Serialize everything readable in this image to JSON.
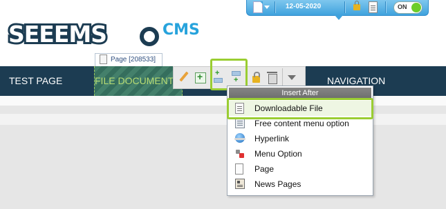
{
  "topbar": {
    "date": "12-05-2020",
    "toggle_label": "ON"
  },
  "logo": {
    "word": "SEEEMS",
    "suffix": "CMS"
  },
  "page_tag": {
    "label": "Page [208533]"
  },
  "navbar": {
    "items": [
      {
        "label": "TEST PAGE"
      },
      {
        "label": "FILE DOCUMENTS"
      },
      {
        "label": "NAVIGATION"
      }
    ]
  },
  "menu": {
    "header": "Insert After",
    "items": [
      {
        "label": "Downloadable File",
        "icon": "document-icon",
        "active": true
      },
      {
        "label": "Free content menu option",
        "icon": "content-icon"
      },
      {
        "label": "Hyperlink",
        "icon": "globe-icon"
      },
      {
        "label": "Menu Option",
        "icon": "menu-option-icon"
      },
      {
        "label": "Page",
        "icon": "page-icon"
      },
      {
        "label": "News Pages",
        "icon": "news-icon"
      }
    ]
  },
  "colors": {
    "nav_background": "#1c3c52",
    "highlight": "#9acd32",
    "topbar_blue": "#3fa2dd",
    "logo_accent": "#27a3dc"
  }
}
